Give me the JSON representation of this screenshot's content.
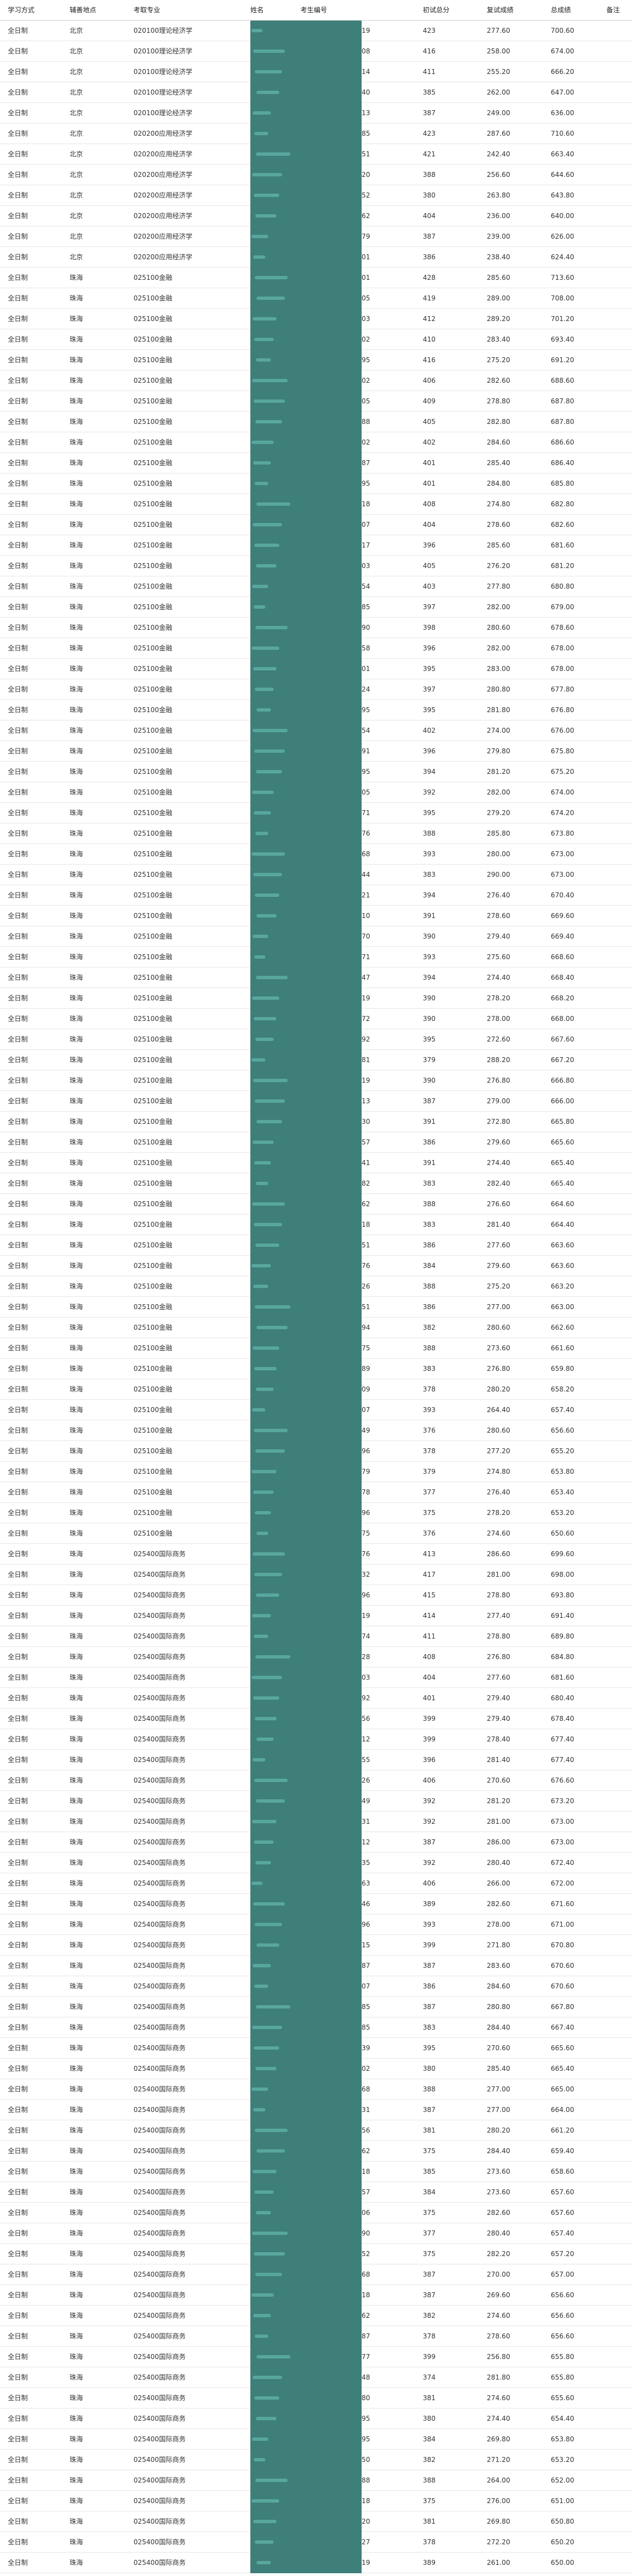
{
  "table": {
    "headers": {
      "mode": "学习方式",
      "location": "辅善地点",
      "major": "考取专业",
      "name": "姓名",
      "exam_id": "考生编号",
      "initial": "初试总分",
      "retest": "复试成绩",
      "total": "总成绩",
      "note": "备注"
    },
    "rows": [
      [
        "全日制",
        "北京",
        "020100理论经济学",
        "19",
        "423",
        "277.60",
        "700.60"
      ],
      [
        "全日制",
        "北京",
        "020100理论经济学",
        "08",
        "416",
        "258.00",
        "674.00"
      ],
      [
        "全日制",
        "北京",
        "020100理论经济学",
        "14",
        "411",
        "255.20",
        "666.20"
      ],
      [
        "全日制",
        "北京",
        "020100理论经济学",
        "40",
        "385",
        "262.00",
        "647.00"
      ],
      [
        "全日制",
        "北京",
        "020100理论经济学",
        "13",
        "387",
        "249.00",
        "636.00"
      ],
      [
        "全日制",
        "北京",
        "020200应用经济学",
        "85",
        "423",
        "287.60",
        "710.60"
      ],
      [
        "全日制",
        "北京",
        "020200应用经济学",
        "51",
        "421",
        "242.40",
        "663.40"
      ],
      [
        "全日制",
        "北京",
        "020200应用经济学",
        "20",
        "388",
        "256.60",
        "644.60"
      ],
      [
        "全日制",
        "北京",
        "020200应用经济学",
        "52",
        "380",
        "263.80",
        "643.80"
      ],
      [
        "全日制",
        "北京",
        "020200应用经济学",
        "62",
        "404",
        "236.00",
        "640.00"
      ],
      [
        "全日制",
        "北京",
        "020200应用经济学",
        "79",
        "387",
        "239.00",
        "626.00"
      ],
      [
        "全日制",
        "北京",
        "020200应用经济学",
        "01",
        "386",
        "238.40",
        "624.40"
      ],
      [
        "全日制",
        "珠海",
        "025100金融",
        "01",
        "428",
        "285.60",
        "713.60"
      ],
      [
        "全日制",
        "珠海",
        "025100金融",
        "05",
        "419",
        "289.00",
        "708.00"
      ],
      [
        "全日制",
        "珠海",
        "025100金融",
        "03",
        "412",
        "289.20",
        "701.20"
      ],
      [
        "全日制",
        "珠海",
        "025100金融",
        "02",
        "410",
        "283.40",
        "693.40"
      ],
      [
        "全日制",
        "珠海",
        "025100金融",
        "95",
        "416",
        "275.20",
        "691.20"
      ],
      [
        "全日制",
        "珠海",
        "025100金融",
        "02",
        "406",
        "282.60",
        "688.60"
      ],
      [
        "全日制",
        "珠海",
        "025100金融",
        "05",
        "409",
        "278.80",
        "687.80"
      ],
      [
        "全日制",
        "珠海",
        "025100金融",
        "88",
        "405",
        "282.80",
        "687.80"
      ],
      [
        "全日制",
        "珠海",
        "025100金融",
        "02",
        "402",
        "284.60",
        "686.60"
      ],
      [
        "全日制",
        "珠海",
        "025100金融",
        "87",
        "401",
        "285.40",
        "686.40"
      ],
      [
        "全日制",
        "珠海",
        "025100金融",
        "95",
        "401",
        "284.80",
        "685.80"
      ],
      [
        "全日制",
        "珠海",
        "025100金融",
        "18",
        "408",
        "274.80",
        "682.80"
      ],
      [
        "全日制",
        "珠海",
        "025100金融",
        "07",
        "404",
        "278.60",
        "682.60"
      ],
      [
        "全日制",
        "珠海",
        "025100金融",
        "17",
        "396",
        "285.60",
        "681.60"
      ],
      [
        "全日制",
        "珠海",
        "025100金融",
        "03",
        "405",
        "276.20",
        "681.20"
      ],
      [
        "全日制",
        "珠海",
        "025100金融",
        "54",
        "403",
        "277.80",
        "680.80"
      ],
      [
        "全日制",
        "珠海",
        "025100金融",
        "85",
        "397",
        "282.00",
        "679.00"
      ],
      [
        "全日制",
        "珠海",
        "025100金融",
        "90",
        "398",
        "280.60",
        "678.60"
      ],
      [
        "全日制",
        "珠海",
        "025100金融",
        "58",
        "396",
        "282.00",
        "678.00"
      ],
      [
        "全日制",
        "珠海",
        "025100金融",
        "01",
        "395",
        "283.00",
        "678.00"
      ],
      [
        "全日制",
        "珠海",
        "025100金融",
        "24",
        "397",
        "280.80",
        "677.80"
      ],
      [
        "全日制",
        "珠海",
        "025100金融",
        "95",
        "395",
        "281.80",
        "676.80"
      ],
      [
        "全日制",
        "珠海",
        "025100金融",
        "54",
        "402",
        "274.00",
        "676.00"
      ],
      [
        "全日制",
        "珠海",
        "025100金融",
        "91",
        "396",
        "279.80",
        "675.80"
      ],
      [
        "全日制",
        "珠海",
        "025100金融",
        "95",
        "394",
        "281.20",
        "675.20"
      ],
      [
        "全日制",
        "珠海",
        "025100金融",
        "05",
        "392",
        "282.00",
        "674.00"
      ],
      [
        "全日制",
        "珠海",
        "025100金融",
        "71",
        "395",
        "279.20",
        "674.20"
      ],
      [
        "全日制",
        "珠海",
        "025100金融",
        "76",
        "388",
        "285.80",
        "673.80"
      ],
      [
        "全日制",
        "珠海",
        "025100金融",
        "68",
        "393",
        "280.00",
        "673.00"
      ],
      [
        "全日制",
        "珠海",
        "025100金融",
        "44",
        "383",
        "290.00",
        "673.00"
      ],
      [
        "全日制",
        "珠海",
        "025100金融",
        "21",
        "394",
        "276.40",
        "670.40"
      ],
      [
        "全日制",
        "珠海",
        "025100金融",
        "10",
        "391",
        "278.60",
        "669.60"
      ],
      [
        "全日制",
        "珠海",
        "025100金融",
        "70",
        "390",
        "279.40",
        "669.40"
      ],
      [
        "全日制",
        "珠海",
        "025100金融",
        "71",
        "393",
        "275.60",
        "668.60"
      ],
      [
        "全日制",
        "珠海",
        "025100金融",
        "47",
        "394",
        "274.40",
        "668.40"
      ],
      [
        "全日制",
        "珠海",
        "025100金融",
        "19",
        "390",
        "278.20",
        "668.20"
      ],
      [
        "全日制",
        "珠海",
        "025100金融",
        "72",
        "390",
        "278.00",
        "668.00"
      ],
      [
        "全日制",
        "珠海",
        "025100金融",
        "92",
        "395",
        "272.60",
        "667.60"
      ],
      [
        "全日制",
        "珠海",
        "025100金融",
        "81",
        "379",
        "288.20",
        "667.20"
      ],
      [
        "全日制",
        "珠海",
        "025100金融",
        "19",
        "390",
        "276.80",
        "666.80"
      ],
      [
        "全日制",
        "珠海",
        "025100金融",
        "13",
        "387",
        "279.00",
        "666.00"
      ],
      [
        "全日制",
        "珠海",
        "025100金融",
        "30",
        "391",
        "272.80",
        "665.80"
      ],
      [
        "全日制",
        "珠海",
        "025100金融",
        "57",
        "386",
        "279.60",
        "665.60"
      ],
      [
        "全日制",
        "珠海",
        "025100金融",
        "41",
        "391",
        "274.40",
        "665.40"
      ],
      [
        "全日制",
        "珠海",
        "025100金融",
        "82",
        "383",
        "282.40",
        "665.40"
      ],
      [
        "全日制",
        "珠海",
        "025100金融",
        "62",
        "388",
        "276.60",
        "664.60"
      ],
      [
        "全日制",
        "珠海",
        "025100金融",
        "18",
        "383",
        "281.40",
        "664.40"
      ],
      [
        "全日制",
        "珠海",
        "025100金融",
        "51",
        "386",
        "277.60",
        "663.60"
      ],
      [
        "全日制",
        "珠海",
        "025100金融",
        "76",
        "384",
        "279.60",
        "663.60"
      ],
      [
        "全日制",
        "珠海",
        "025100金融",
        "26",
        "388",
        "275.20",
        "663.20"
      ],
      [
        "全日制",
        "珠海",
        "025100金融",
        "51",
        "386",
        "277.00",
        "663.00"
      ],
      [
        "全日制",
        "珠海",
        "025100金融",
        "94",
        "382",
        "280.60",
        "662.60"
      ],
      [
        "全日制",
        "珠海",
        "025100金融",
        "75",
        "388",
        "273.60",
        "661.60"
      ],
      [
        "全日制",
        "珠海",
        "025100金融",
        "89",
        "383",
        "276.80",
        "659.80"
      ],
      [
        "全日制",
        "珠海",
        "025100金融",
        "09",
        "378",
        "280.20",
        "658.20"
      ],
      [
        "全日制",
        "珠海",
        "025100金融",
        "07",
        "393",
        "264.40",
        "657.40"
      ],
      [
        "全日制",
        "珠海",
        "025100金融",
        "49",
        "376",
        "280.60",
        "656.60"
      ],
      [
        "全日制",
        "珠海",
        "025100金融",
        "96",
        "378",
        "277.20",
        "655.20"
      ],
      [
        "全日制",
        "珠海",
        "025100金融",
        "79",
        "379",
        "274.80",
        "653.80"
      ],
      [
        "全日制",
        "珠海",
        "025100金融",
        "78",
        "377",
        "276.40",
        "653.40"
      ],
      [
        "全日制",
        "珠海",
        "025100金融",
        "96",
        "375",
        "278.20",
        "653.20"
      ],
      [
        "全日制",
        "珠海",
        "025100金融",
        "75",
        "376",
        "274.60",
        "650.60"
      ],
      [
        "全日制",
        "珠海",
        "025400国际商务",
        "76",
        "413",
        "286.60",
        "699.60"
      ],
      [
        "全日制",
        "珠海",
        "025400国际商务",
        "32",
        "417",
        "281.00",
        "698.00"
      ],
      [
        "全日制",
        "珠海",
        "025400国际商务",
        "96",
        "415",
        "278.80",
        "693.80"
      ],
      [
        "全日制",
        "珠海",
        "025400国际商务",
        "19",
        "414",
        "277.40",
        "691.40"
      ],
      [
        "全日制",
        "珠海",
        "025400国际商务",
        "74",
        "411",
        "278.80",
        "689.80"
      ],
      [
        "全日制",
        "珠海",
        "025400国际商务",
        "28",
        "408",
        "276.80",
        "684.80"
      ],
      [
        "全日制",
        "珠海",
        "025400国际商务",
        "03",
        "404",
        "277.60",
        "681.60"
      ],
      [
        "全日制",
        "珠海",
        "025400国际商务",
        "92",
        "401",
        "279.40",
        "680.40"
      ],
      [
        "全日制",
        "珠海",
        "025400国际商务",
        "56",
        "399",
        "279.40",
        "678.40"
      ],
      [
        "全日制",
        "珠海",
        "025400国际商务",
        "12",
        "399",
        "278.40",
        "677.40"
      ],
      [
        "全日制",
        "珠海",
        "025400国际商务",
        "55",
        "396",
        "281.40",
        "677.40"
      ],
      [
        "全日制",
        "珠海",
        "025400国际商务",
        "26",
        "406",
        "270.60",
        "676.60"
      ],
      [
        "全日制",
        "珠海",
        "025400国际商务",
        "49",
        "392",
        "281.20",
        "673.20"
      ],
      [
        "全日制",
        "珠海",
        "025400国际商务",
        "31",
        "392",
        "281.00",
        "673.00"
      ],
      [
        "全日制",
        "珠海",
        "025400国际商务",
        "12",
        "387",
        "286.00",
        "673.00"
      ],
      [
        "全日制",
        "珠海",
        "025400国际商务",
        "35",
        "392",
        "280.40",
        "672.40"
      ],
      [
        "全日制",
        "珠海",
        "025400国际商务",
        "63",
        "406",
        "266.00",
        "672.00"
      ],
      [
        "全日制",
        "珠海",
        "025400国际商务",
        "46",
        "389",
        "282.60",
        "671.60"
      ],
      [
        "全日制",
        "珠海",
        "025400国际商务",
        "96",
        "393",
        "278.00",
        "671.00"
      ],
      [
        "全日制",
        "珠海",
        "025400国际商务",
        "15",
        "399",
        "271.80",
        "670.80"
      ],
      [
        "全日制",
        "珠海",
        "025400国际商务",
        "87",
        "387",
        "283.60",
        "670.60"
      ],
      [
        "全日制",
        "珠海",
        "025400国际商务",
        "07",
        "386",
        "284.60",
        "670.60"
      ],
      [
        "全日制",
        "珠海",
        "025400国际商务",
        "85",
        "387",
        "280.80",
        "667.80"
      ],
      [
        "全日制",
        "珠海",
        "025400国际商务",
        "85",
        "383",
        "284.40",
        "667.40"
      ],
      [
        "全日制",
        "珠海",
        "025400国际商务",
        "39",
        "395",
        "270.60",
        "665.60"
      ],
      [
        "全日制",
        "珠海",
        "025400国际商务",
        "02",
        "380",
        "285.40",
        "665.40"
      ],
      [
        "全日制",
        "珠海",
        "025400国际商务",
        "68",
        "388",
        "277.00",
        "665.00"
      ],
      [
        "全日制",
        "珠海",
        "025400国际商务",
        "31",
        "387",
        "277.00",
        "664.00"
      ],
      [
        "全日制",
        "珠海",
        "025400国际商务",
        "56",
        "381",
        "280.20",
        "661.20"
      ],
      [
        "全日制",
        "珠海",
        "025400国际商务",
        "62",
        "375",
        "284.40",
        "659.40"
      ],
      [
        "全日制",
        "珠海",
        "025400国际商务",
        "18",
        "385",
        "273.60",
        "658.60"
      ],
      [
        "全日制",
        "珠海",
        "025400国际商务",
        "57",
        "384",
        "273.60",
        "657.60"
      ],
      [
        "全日制",
        "珠海",
        "025400国际商务",
        "06",
        "375",
        "282.60",
        "657.60"
      ],
      [
        "全日制",
        "珠海",
        "025400国际商务",
        "90",
        "377",
        "280.40",
        "657.40"
      ],
      [
        "全日制",
        "珠海",
        "025400国际商务",
        "52",
        "375",
        "282.20",
        "657.20"
      ],
      [
        "全日制",
        "珠海",
        "025400国际商务",
        "68",
        "387",
        "270.00",
        "657.00"
      ],
      [
        "全日制",
        "珠海",
        "025400国际商务",
        "18",
        "387",
        "269.60",
        "656.60"
      ],
      [
        "全日制",
        "珠海",
        "025400国际商务",
        "62",
        "382",
        "274.60",
        "656.60"
      ],
      [
        "全日制",
        "珠海",
        "025400国际商务",
        "87",
        "378",
        "278.60",
        "656.60"
      ],
      [
        "全日制",
        "珠海",
        "025400国际商务",
        "77",
        "399",
        "256.80",
        "655.80"
      ],
      [
        "全日制",
        "珠海",
        "025400国际商务",
        "48",
        "374",
        "281.80",
        "655.80"
      ],
      [
        "全日制",
        "珠海",
        "025400国际商务",
        "80",
        "381",
        "274.60",
        "655.60"
      ],
      [
        "全日制",
        "珠海",
        "025400国际商务",
        "95",
        "380",
        "274.40",
        "654.40"
      ],
      [
        "全日制",
        "珠海",
        "025400国际商务",
        "95",
        "384",
        "269.80",
        "653.80"
      ],
      [
        "全日制",
        "珠海",
        "025400国际商务",
        "50",
        "382",
        "271.20",
        "653.20"
      ],
      [
        "全日制",
        "珠海",
        "025400国际商务",
        "88",
        "388",
        "264.00",
        "652.00"
      ],
      [
        "全日制",
        "珠海",
        "025400国际商务",
        "18",
        "375",
        "276.00",
        "651.00"
      ],
      [
        "全日制",
        "珠海",
        "025400国际商务",
        "20",
        "381",
        "269.80",
        "650.80"
      ],
      [
        "全日制",
        "珠海",
        "025400国际商务",
        "27",
        "378",
        "272.20",
        "650.20"
      ],
      [
        "全日制",
        "珠海",
        "025400国际商务",
        "19",
        "389",
        "261.00",
        "650.00"
      ]
    ]
  }
}
